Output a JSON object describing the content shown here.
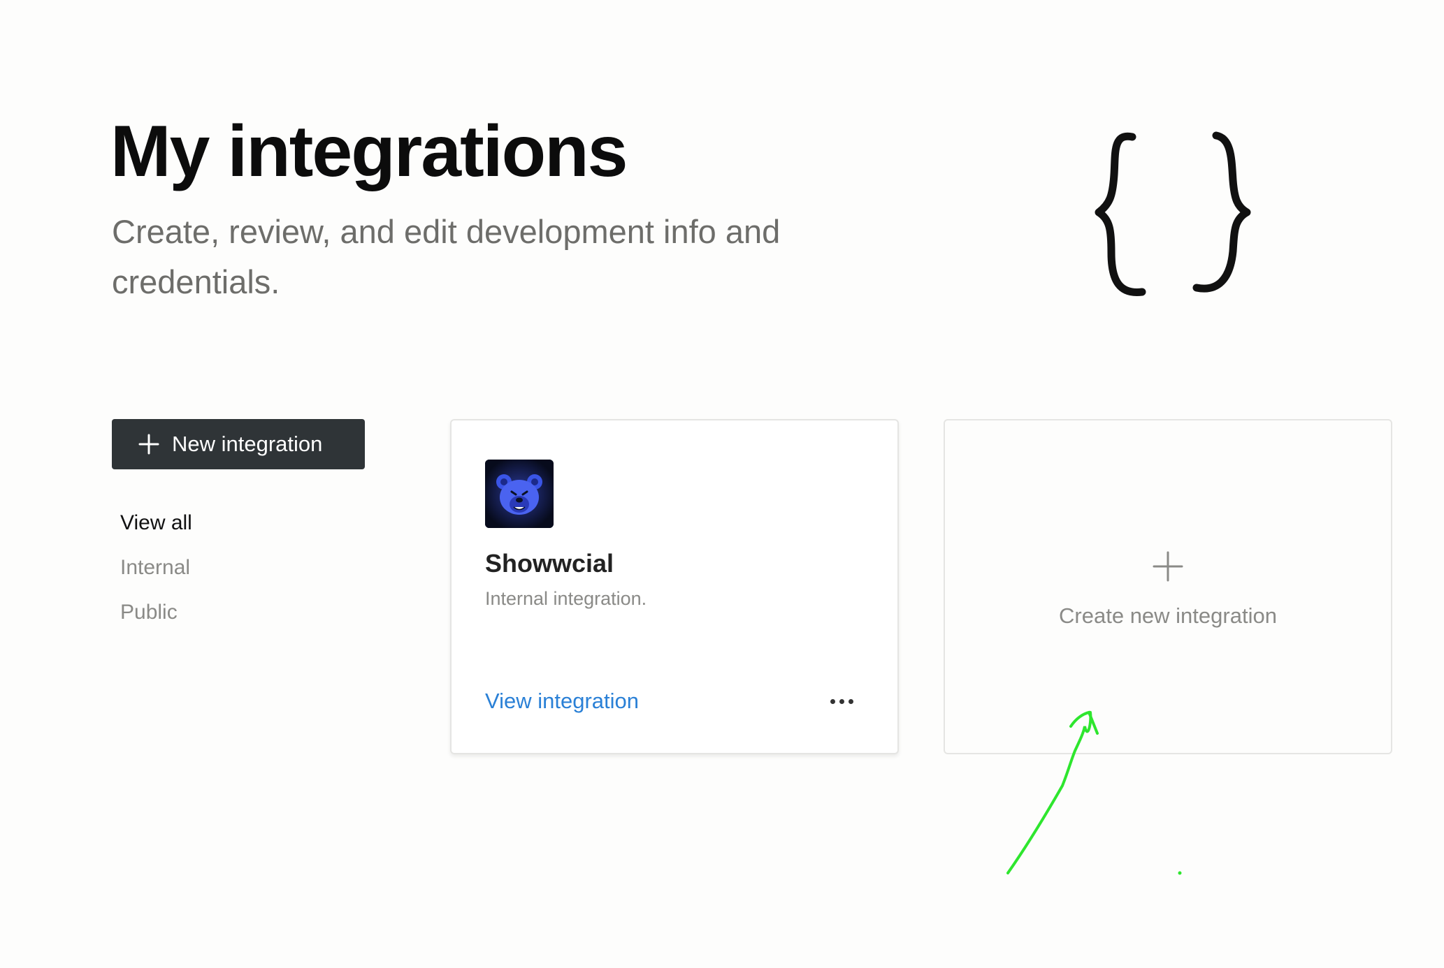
{
  "header": {
    "title": "My integrations",
    "subtitle": "Create, review, and edit development info and credentials.",
    "illustration_icon": "curly-braces-icon"
  },
  "toolbar": {
    "new_button_label": "New integration",
    "new_button_icon": "plus-icon"
  },
  "filters": {
    "items": [
      {
        "label": "View all",
        "active": true
      },
      {
        "label": "Internal",
        "active": false
      },
      {
        "label": "Public",
        "active": false
      }
    ]
  },
  "integrations": [
    {
      "name": "Showwcial",
      "description": "Internal integration.",
      "link_label": "View integration",
      "icon": "bear-avatar-icon",
      "more_icon": "more-horizontal-icon"
    }
  ],
  "create_card": {
    "label": "Create new integration",
    "icon": "plus-icon"
  },
  "colors": {
    "background": "#fdfdfc",
    "primary_button": "#2f3437",
    "link": "#2a80d6",
    "muted_text": "#8a8a87",
    "annotation": "#2ee62e"
  }
}
